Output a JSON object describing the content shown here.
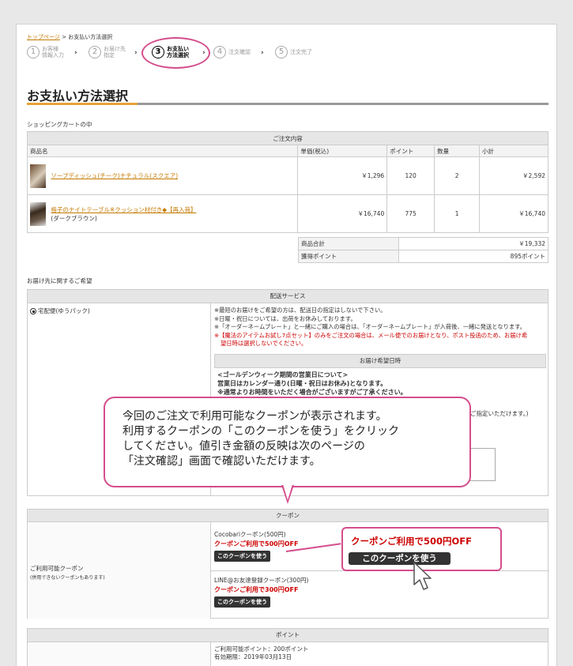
{
  "breadcrumb": {
    "home": "トップページ",
    "current": "お支払い方法選択"
  },
  "steps": [
    {
      "num": "1",
      "line1": "お客様",
      "line2": "情報入力"
    },
    {
      "num": "2",
      "line1": "お届け先",
      "line2": "指定"
    },
    {
      "num": "3",
      "line1": "お支払い",
      "line2": "方法選択"
    },
    {
      "num": "4",
      "line1": "注文確認",
      "line2": ""
    },
    {
      "num": "5",
      "line1": "注文完了",
      "line2": ""
    }
  ],
  "page_title": "お支払い方法選択",
  "cart": {
    "label": "ショッピングカートの中",
    "header": "ご注文内容",
    "columns": [
      "商品名",
      "単価(税込)",
      "ポイント",
      "数量",
      "小計"
    ],
    "rows": [
      {
        "name": "ソープディッシュ(チーク)ナチュラル(スクエア)",
        "sub": "",
        "price": "￥1,296",
        "points": "120",
        "qty": "2",
        "subtotal": "￥2,592"
      },
      {
        "name": "格子のナイトテーブル※クッション材付き◆【再入荷】",
        "sub": "(ダークブラウン)",
        "price": "￥16,740",
        "points": "775",
        "qty": "1",
        "subtotal": "￥16,740"
      }
    ],
    "total_label": "商品合計",
    "total_value": "￥19,332",
    "points_label": "獲得ポイント",
    "points_value": "895ポイント"
  },
  "delivery": {
    "label": "お届け先に関するご希望",
    "header": "配送サービス",
    "option": "宅配便(ゆうパック)",
    "notes": [
      "※最短のお届けをご希望の方は、配送日の指定はしないで下さい。",
      "※日曜・祝日については、出荷をお休みしております。",
      "※「オーダーネームプレート」と一緒にご購入の場合は、「オーダーネームプレート」が入荷後、一緒に発送となります。"
    ],
    "red_note_1": "※【魔法のアイテムお試し7点セット】のみをご注文の場合は、メール便でのお届けとなり、ポスト投函のため、お届け希",
    "red_note_2": "望日時は選択しないでください。",
    "date_header": "お届け希望日時",
    "gw_title": "<ゴールデンウィーク期間の営業日について>",
    "gw_line": "営業日はカレンダー通り(日曜・祝日はお休み)となります。",
    "gw_cut": "※通常よりお時間をいただく場合がございますがご了承ください。",
    "date_partial": "ご指定いただけます。)"
  },
  "callout": {
    "line1": "今回のご注文で利用可能なクーポンが表示されます。",
    "line2": "利用するクーポンの「このクーポンを使う」をクリック",
    "line3": "してください。値引き金額の反映は次のページの",
    "line4": "「注文確認」画面で確認いただけます。"
  },
  "coupon": {
    "header": "クーポン",
    "label": "ご利用可能クーポン",
    "sublabel": "(併用できないクーポンもあります)",
    "items": [
      {
        "name": "Cocobariクーポン(500円)",
        "discount": "クーポンご利用で500円OFF",
        "button": "このクーポンを使う"
      },
      {
        "name": "LINE@お友達登録クーポン(300円)",
        "discount": "クーポンご利用で300円OFF",
        "button": "このクーポンを使う"
      }
    ],
    "zoom_discount": "クーポンご利用で500円OFF",
    "zoom_button": "このクーポンを使う"
  },
  "points": {
    "header": "ポイント",
    "available": "ご利用可能ポイント：200ポイント",
    "expiry": "有効期限：2019年03月13日"
  },
  "colors": {
    "accent": "#d44d8c",
    "link": "#c47a00",
    "red": "#cc0000"
  }
}
